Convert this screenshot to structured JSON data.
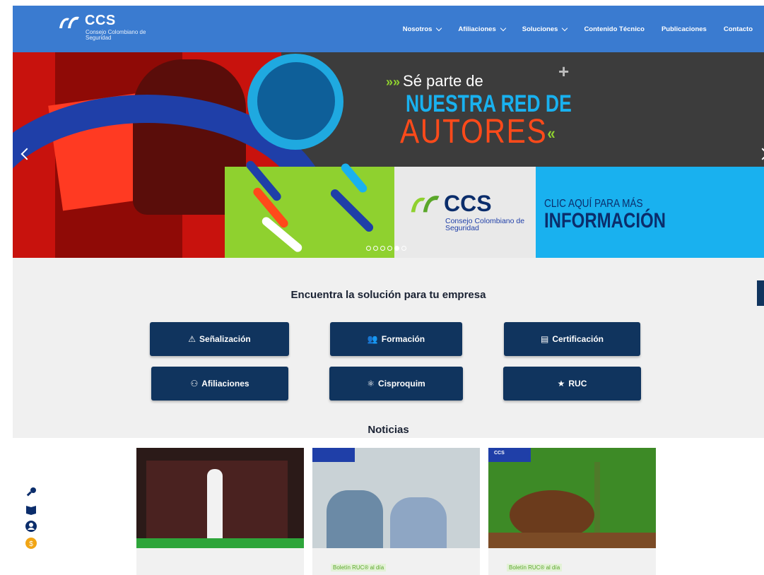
{
  "header": {
    "logo_text": "CCS",
    "logo_sub": "Consejo Colombiano de Seguridad",
    "nav": [
      {
        "label": "Nosotros",
        "dropdown": true
      },
      {
        "label": "Afiliaciones",
        "dropdown": true
      },
      {
        "label": "Soluciones",
        "dropdown": true
      },
      {
        "label": "Contenido Técnico",
        "dropdown": false
      },
      {
        "label": "Publicaciones",
        "dropdown": false
      },
      {
        "label": "Contacto",
        "dropdown": false
      }
    ]
  },
  "hero": {
    "line1": "Sé parte de",
    "line2": "NUESTRA RED DE",
    "line3": "AUTORES",
    "brand": "CCS",
    "brand_sub": "Consejo Colombiano de Seguridad",
    "cta_small": "CLIC AQUÍ PARA MÁS",
    "cta_big": "INFORMACIÓN",
    "slide_count": 6,
    "active_slide": 5
  },
  "solutions": {
    "title": "Encuentra la solución para tu empresa",
    "buttons": [
      {
        "label": "Señalización",
        "icon": "warning-icon"
      },
      {
        "label": "Formación",
        "icon": "users-icon"
      },
      {
        "label": "Certificación",
        "icon": "document-icon"
      },
      {
        "label": "Afiliaciones",
        "icon": "handshake-icon"
      },
      {
        "label": "Cisproquim",
        "icon": "atom-icon"
      },
      {
        "label": "RUC",
        "icon": "star-icon"
      }
    ]
  },
  "news": {
    "title": "Noticias",
    "cards": [
      {
        "tag": ""
      },
      {
        "tag": "Boletín RUC® al día"
      },
      {
        "tag": "Boletín RUC® al día"
      }
    ]
  },
  "colors": {
    "header_bg": "#3a7bd0",
    "button_bg": "#10345e",
    "section_bg": "#f0f0f0"
  }
}
